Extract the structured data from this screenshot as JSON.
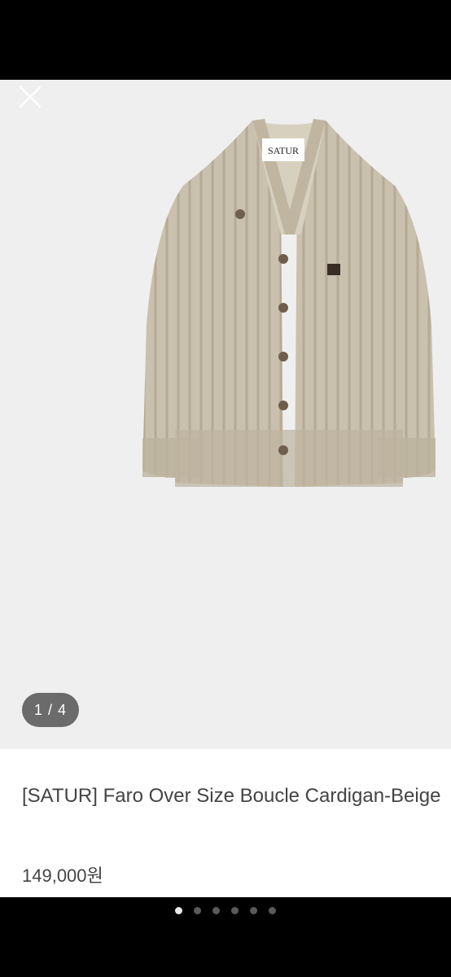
{
  "gallery": {
    "counter": "1 / 4",
    "image": {
      "brand_tag": "SATUR",
      "color": "#c5bca9"
    }
  },
  "product": {
    "title": "[SATUR] Faro Over Size Boucle Cardigan-Beige",
    "price": "149,000원"
  },
  "pager": {
    "total": 6,
    "active_index": 0
  },
  "colors": {
    "gallery_bg": "#efefef",
    "counter_bg": "#6b6b6b",
    "text": "#444444"
  },
  "icons": {
    "close": "close-icon"
  }
}
